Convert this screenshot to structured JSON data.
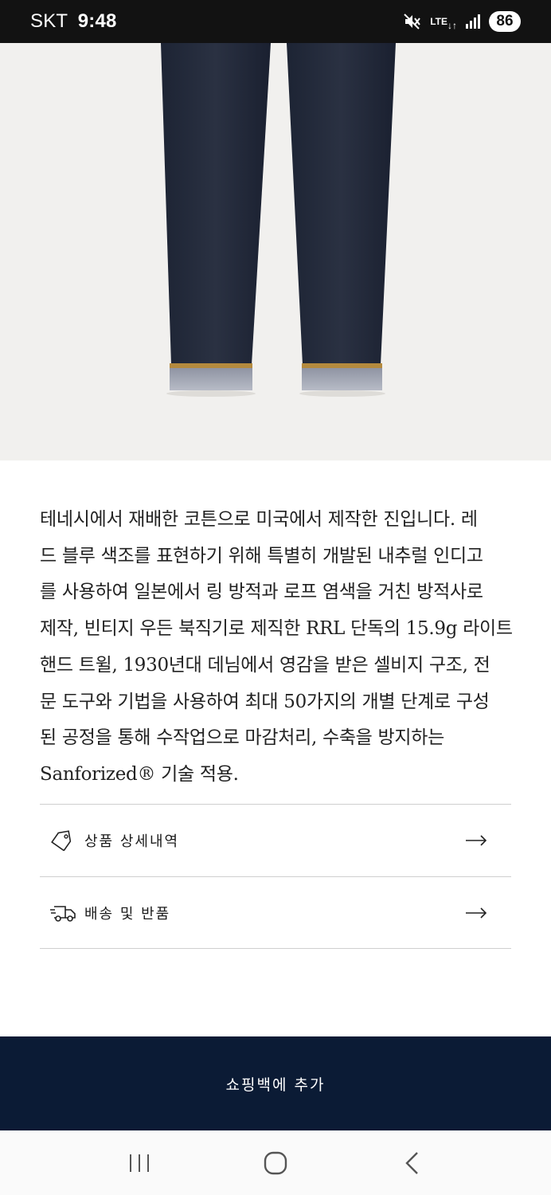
{
  "status_bar": {
    "carrier": "SKT",
    "time": "9:48",
    "network": "LTE",
    "battery": "86",
    "icons": [
      "mute-icon",
      "lte-icon",
      "signal-icon",
      "battery-icon"
    ]
  },
  "product": {
    "image_label": "jeans-product-image",
    "description_lines": [
      "테네시에서 재배한 코튼으로 미국에서 제작한 진입니다. 레",
      "드 블루 색조를 표현하기 위해 특별히 개발된 내추럴 인디고",
      "를 사용하여 일본에서 링 방적과 로프 염색을 거친 방적사로",
      "제작, 빈티지 우든 북직기로 제직한 RRL 단독의 15.9g 라이트",
      "핸드 트윌, 1930년대 데님에서 영감을 받은 셀비지 구조, 전",
      "문 도구와 기법을 사용하여 최대 50가지의 개별 단계로 구성",
      "된 공정을 통해 수작업으로 마감처리, 수축을 방지하는",
      "Sanforized® 기술 적용."
    ]
  },
  "accordion": [
    {
      "label": "상품 상세내역",
      "icon": "tag-icon"
    },
    {
      "label": "배송 및 반품",
      "icon": "delivery-truck-icon"
    }
  ],
  "cta": {
    "add_to_bag": "쇼핑백에 추가"
  },
  "colors": {
    "cta_background": "#0b1b35",
    "image_background": "#f1f0ee"
  }
}
